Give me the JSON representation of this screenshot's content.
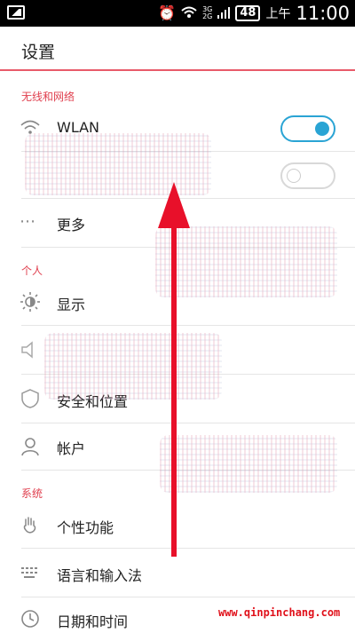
{
  "status_bar": {
    "net_top": "3G",
    "net_bottom": "2G",
    "battery": "48",
    "ampm": "上午",
    "time": "11:00"
  },
  "header": {
    "title": "设置"
  },
  "sections": {
    "wireless": "无线和网络",
    "personal": "个人",
    "system": "系统"
  },
  "items": {
    "wlan": "WLAN",
    "more": "更多",
    "display": "显示",
    "security": "安全和位置",
    "account": "帐户",
    "personalize": "个性功能",
    "language": "语言和输入法",
    "datetime": "日期和时间"
  },
  "toggles": {
    "wlan_on": true,
    "bluetooth_on": false
  },
  "watermark": "www.qinpinchang.com",
  "colors": {
    "accent_red": "#e0404f",
    "toggle_blue": "#2aa4d4",
    "arrow_red": "#e8102a"
  }
}
